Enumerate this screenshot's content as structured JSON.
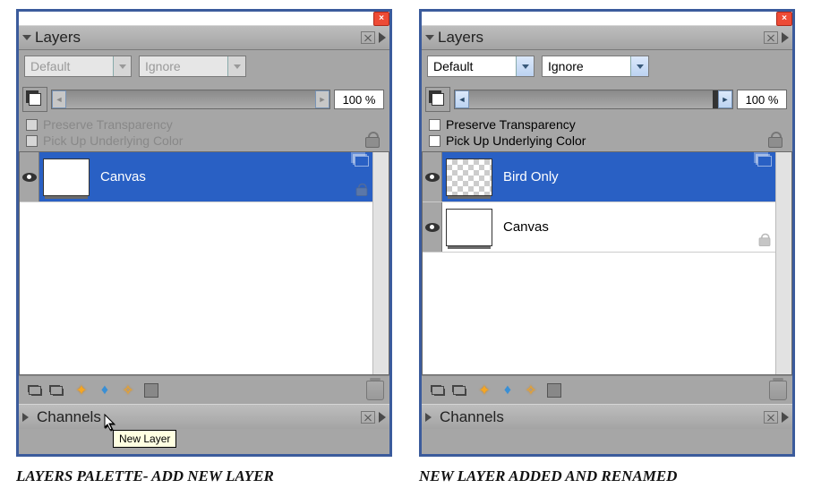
{
  "caption_left": "Layers Palette- Add New Layer",
  "caption_right": "New Layer Added and Renamed",
  "tooltip_new_layer": "New Layer",
  "left": {
    "header_title": "Layers",
    "dropdown1": "Default",
    "dropdown2": "Ignore",
    "opacity": "100 %",
    "preserve_label": "Preserve Transparency",
    "pickup_label": "Pick Up Underlying Color",
    "channels_title": "Channels",
    "layers": [
      {
        "name": "Canvas",
        "selected": true,
        "checker": false
      }
    ]
  },
  "right": {
    "header_title": "Layers",
    "dropdown1": "Default",
    "dropdown2": "Ignore",
    "opacity": "100 %",
    "preserve_label": "Preserve Transparency",
    "pickup_label": "Pick Up Underlying Color",
    "channels_title": "Channels",
    "layers": [
      {
        "name": "Bird Only",
        "selected": true,
        "checker": true
      },
      {
        "name": "Canvas",
        "selected": false,
        "checker": false
      }
    ]
  }
}
